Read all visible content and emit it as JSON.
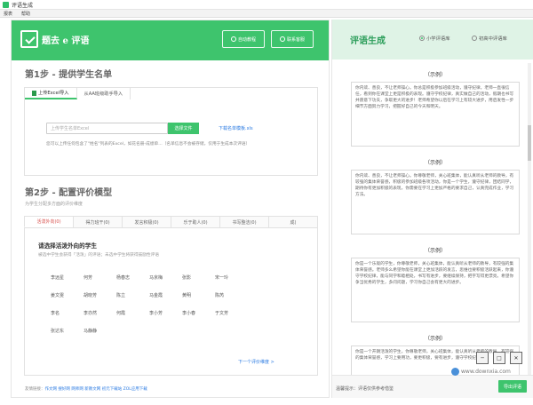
{
  "window": {
    "title": "评语生成"
  },
  "menu": [
    "报表",
    "帮助"
  ],
  "header": {
    "logo_text": "题去 e 评语",
    "btn1": "自动教程",
    "btn2": "联系客服"
  },
  "step1": {
    "title_prefix": "第1步 -",
    "title_main": "提供学生名单",
    "tabs": [
      "上传Excel导入",
      "从AA班级助手导入"
    ],
    "file_placeholder": "上传学生名单Excel",
    "choose_btn": "选择文件",
    "download_link": "下载名单模板.xls",
    "note": "您可以上传任何包含了\"姓名\"列表的Excel，如花名册-成绩单...（名单信息不会被存储，仅用于生成本次评语）"
  },
  "step2": {
    "title_prefix": "第2步 -",
    "title_main": "配置评价模型",
    "subtitle": "为学生分配多方面的评价维度",
    "tabs": [
      "活泼外向(0)",
      "得力班干(0)",
      "发言积极(0)",
      "乐于助人(0)",
      "书写整洁(0)",
      "成("
    ],
    "question": "请选择活泼外向的学生",
    "hint": "被选中学生会获得「活泼」的评语；未选中学生将获得鼓励性评语",
    "names": [
      "李远星",
      "何芳",
      "杨春志",
      "马京梅",
      "张影",
      "宋一玲",
      "",
      "姜文雯",
      "胡晓芳",
      "陈立",
      "马金霞",
      "黄明",
      "陈芮",
      "",
      "李名",
      "李亦然",
      "何霞",
      "李小芳",
      "李小春",
      "于文芳",
      "",
      "张达东",
      "马静静",
      "",
      "",
      "",
      "",
      ""
    ],
    "next_link": "下一个评价维度 >"
  },
  "footer": {
    "label": "友情链接：",
    "links": "作文网 搜好网 网师网 新教文网 初元下载站 ZOL应用下载"
  },
  "right": {
    "title": "评语生成",
    "options": [
      "小学评语库",
      "初高中评语库"
    ],
    "samples": [
      {
        "label": "（示例）",
        "text": "你内敛、善良，不让老师操心。你总是积极参加班级活动，遵守纪律，老师一直很信任，看到你在课堂上更是积极的表现。遵守学校纪律，真实做自己的活动，假期也书写并愿意下功夫，争取更大的进步！老师希望你以后在学习上有较大进步，用启发性一步细节方面努力学习，把握好自己的今天和明天。"
      },
      {
        "label": "（示例）",
        "text": "你内敛、善良，不让老师操心。你尊敬老师，关心班集体，能认真听从老师的教导，有较强的集体荣誉感，积极的参加班级各项活动，你是一个学生，遵守纪律，团结同学，期待你有更加积极的表现，你需要在学习上更加严格的要求自己，认真完成作业，学习方法。"
      },
      {
        "label": "（示例）",
        "text": "你是一个乐观的学生，你尊敬老师，关心班集体，能认真听从老师的教导，有较强的集体荣誉感。老师多么希望你能在课堂上更加活跃的发言，思维也要积极活跃起来，你遵守学校纪律，能与同学和睦相处，书写有进步，要继续保持，把字写得更漂亮。希望你争当优秀的学生，多问问题，学习你自己会有更大的进步。"
      },
      {
        "label": "（示例）",
        "text": "你是一个开朗活泼的学生，你尊敬老师，关心班集体，能认真听从老师的教导，有较强的集体荣誉感，学习上要用功，要更积极，要有进步，遵守学校纪律。"
      }
    ],
    "tip": "温馨提示：评语仅供参考借鉴",
    "export_btn": "导出评语"
  },
  "watermark": {
    "text": "www.downxia.com"
  },
  "colors": {
    "brand_green": "#3ec46d",
    "tab_active_red": "#d9534f",
    "link_blue": "#2a7ae2"
  }
}
